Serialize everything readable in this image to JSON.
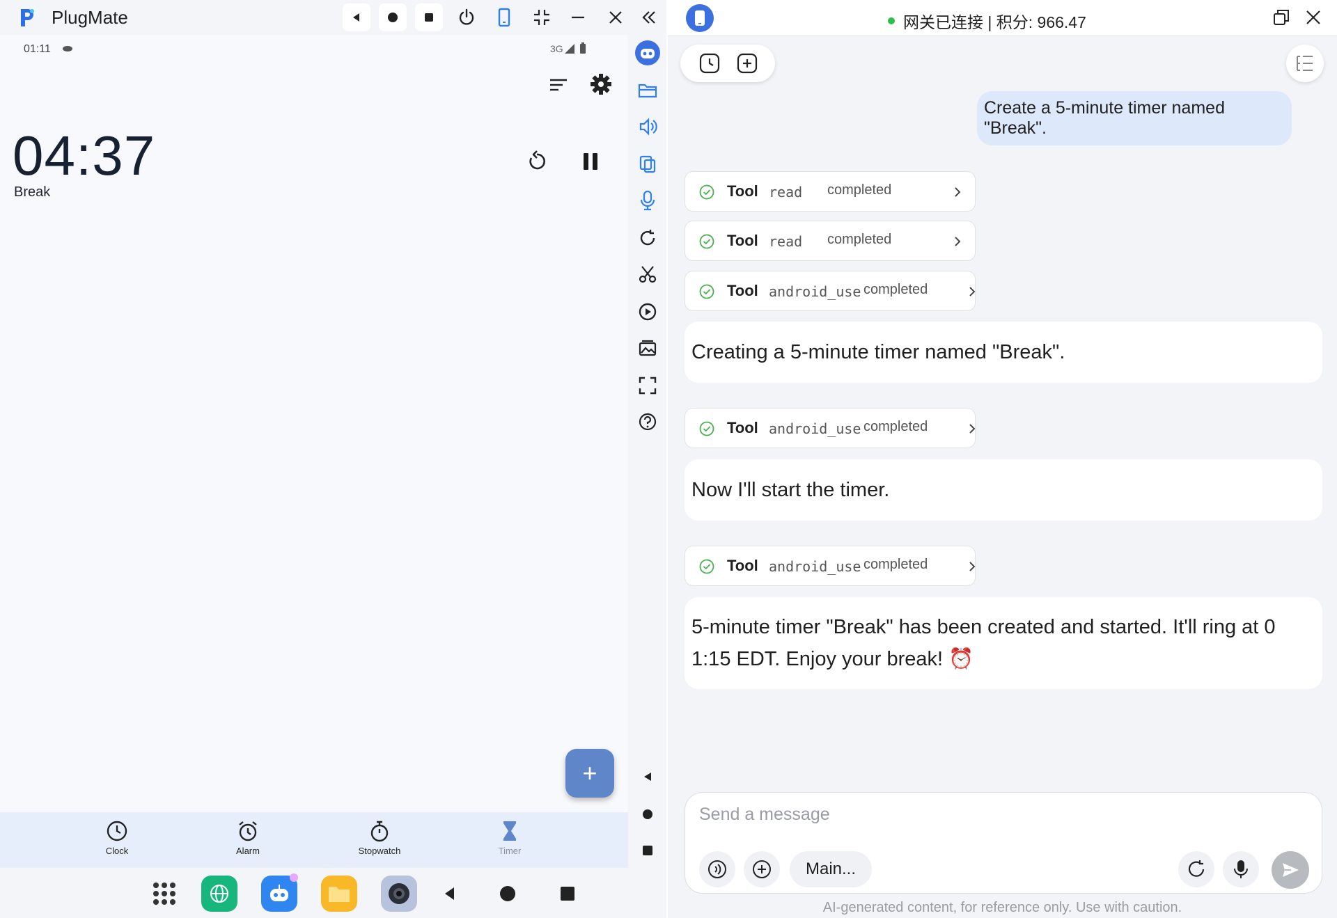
{
  "left_window": {
    "app_title": "PlugMate",
    "titlebar_buttons": [
      "back-triangle-icon",
      "home-circle-icon",
      "recents-square-icon",
      "power-icon",
      "rotate-phone-icon",
      "shrink-icon",
      "minimize-icon",
      "close-icon",
      "collapse-chevrons-icon"
    ]
  },
  "phone": {
    "status": {
      "time": "01:11",
      "network": "3G"
    },
    "timer": {
      "value": "04:37",
      "label": "Break"
    },
    "fab_label": "+",
    "bottom_nav": [
      {
        "label": "Clock",
        "icon": "clock-icon",
        "active": false
      },
      {
        "label": "Alarm",
        "icon": "alarm-icon",
        "active": false
      },
      {
        "label": "Stopwatch",
        "icon": "stopwatch-icon",
        "active": false
      },
      {
        "label": "Timer",
        "icon": "hourglass-icon",
        "active": true
      }
    ],
    "taskbar_apps": [
      "app-drawer-icon",
      "browser-icon",
      "robot-app-icon",
      "files-app-icon",
      "camera-app-icon"
    ]
  },
  "side_toolbar": {
    "icons": [
      "assistant-icon",
      "folder-icon",
      "volume-icon",
      "copy-icon",
      "microphone-icon",
      "refresh-icon",
      "scissors-icon",
      "play-icon",
      "gallery-icon",
      "fullscreen-icon",
      "help-icon",
      "back-icon",
      "home-icon",
      "recents-icon"
    ]
  },
  "right_window": {
    "connection_status": "网关已连接 | 积分: 966.47",
    "messages": {
      "user_1": "Create a 5-minute timer named \"Break\".",
      "tool_1": {
        "tool": "Tool",
        "name": "read",
        "status": "completed"
      },
      "tool_2": {
        "tool": "Tool",
        "name": "read",
        "status": "completed"
      },
      "tool_3": {
        "tool": "Tool",
        "name": "android_use",
        "status": "completed"
      },
      "ai_1": "Creating a 5-minute timer named \"Break\".",
      "tool_4": {
        "tool": "Tool",
        "name": "android_use",
        "status": "completed"
      },
      "ai_2": "Now I'll start the timer.",
      "tool_5": {
        "tool": "Tool",
        "name": "android_use",
        "status": "completed"
      },
      "ai_3_line1": "5-minute timer \"Break\" has been created and started. It'll ring at 0",
      "ai_3_line2": "1:15 EDT. Enjoy your break! ⏰"
    },
    "composer": {
      "placeholder": "Send a message",
      "model": "Main..."
    },
    "disclaimer": "AI-generated content, for reference only. Use with caution."
  },
  "colors": {
    "accent_blue": "#3c6fe0",
    "fab_blue": "#5f86c8",
    "user_bubble": "#dde8fb",
    "success_green": "#27c24c",
    "check_green": "#4caf50"
  }
}
